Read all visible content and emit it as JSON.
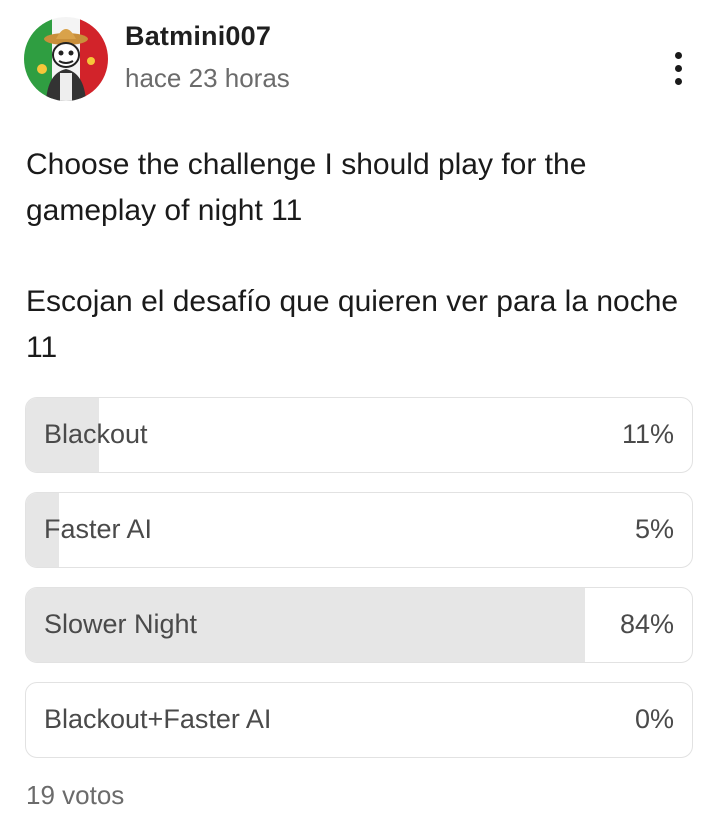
{
  "post": {
    "author": "Batmini007",
    "timestamp": "hace 23 horas",
    "text_en": "Choose the challenge I should play for the gameplay of night 11",
    "text_es": "Escojan el desafío que quieren ver para la noche 11"
  },
  "poll": {
    "options": [
      {
        "label": "Blackout",
        "percent_label": "11%",
        "percent": 11
      },
      {
        "label": "Faster AI",
        "percent_label": "5%",
        "percent": 5
      },
      {
        "label": "Slower Night",
        "percent_label": "84%",
        "percent": 84
      },
      {
        "label": "Blackout+Faster AI",
        "percent_label": "0%",
        "percent": 0
      }
    ],
    "votes": "19 votos"
  },
  "icons": {
    "avatar": "avatar",
    "menu": "more-vertical-icon"
  },
  "colors": {
    "fill": "#e6e6e6",
    "border": "#e2e2e2",
    "secondary_text": "#6b6b6b"
  }
}
